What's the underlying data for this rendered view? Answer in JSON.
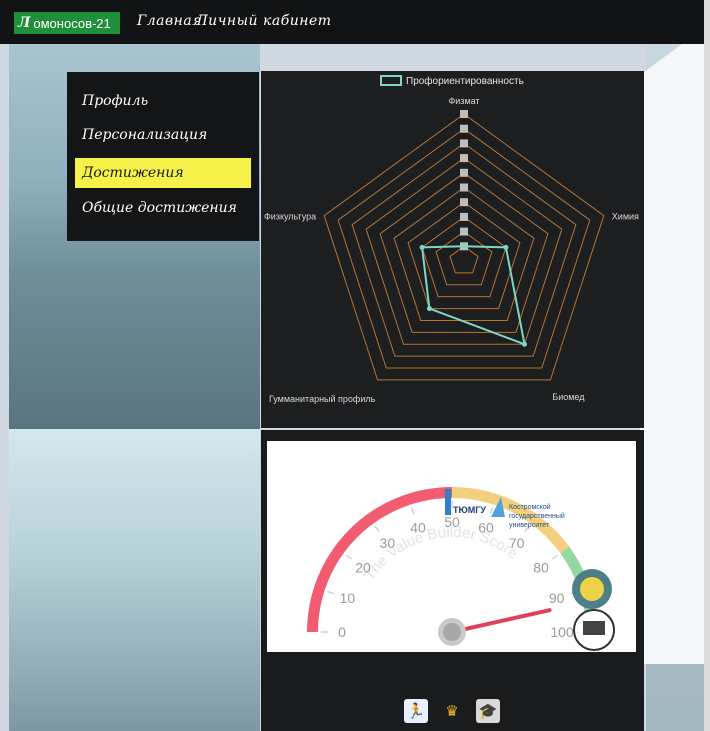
{
  "header": {
    "brand_logo": "Л",
    "brand_label": "омоносов-21",
    "nav": [
      "Главная",
      "Личный кабинет"
    ]
  },
  "menu": {
    "items": [
      {
        "label": "Профиль",
        "active": false
      },
      {
        "label": "Персонализация",
        "active": false
      },
      {
        "label": "Достижения",
        "active": true
      },
      {
        "label": "Общие достижения",
        "active": false
      }
    ]
  },
  "chart_data": {
    "type": "radar",
    "legend": "Профориентированность",
    "axes": [
      "Физмат",
      "Химия",
      "Биомед",
      "Гумманитарный профиль",
      "Физкультура"
    ],
    "rmax": 10,
    "series": [
      {
        "name": "Профориентированность",
        "values": [
          1,
          3,
          7,
          4,
          3
        ]
      }
    ],
    "colors": {
      "grid": "#b8732f",
      "series": "#7fd6c6",
      "tick_box": "#bdbdbd"
    }
  },
  "gauge": {
    "title": "The Value Builder Score",
    "ticks": [
      "0",
      "10",
      "20",
      "30",
      "40",
      "50",
      "60",
      "70",
      "80",
      "90",
      "100"
    ],
    "value": 93,
    "logos": {
      "tyumgu": "ТЮМГУ",
      "kostroma_line1": "Костромской",
      "kostroma_line2": "государственный",
      "kostroma_line3": "университет"
    },
    "colors": {
      "red": "#f25c70",
      "yellow": "#f3cf7e",
      "green": "#93d9a0",
      "needle": "#e0405a"
    }
  },
  "bottom_icons": [
    {
      "name": "runner-icon",
      "glyph": "🏃"
    },
    {
      "name": "crown-icon",
      "glyph": "♛"
    },
    {
      "name": "graduation-cap-icon",
      "glyph": "🎓"
    }
  ]
}
